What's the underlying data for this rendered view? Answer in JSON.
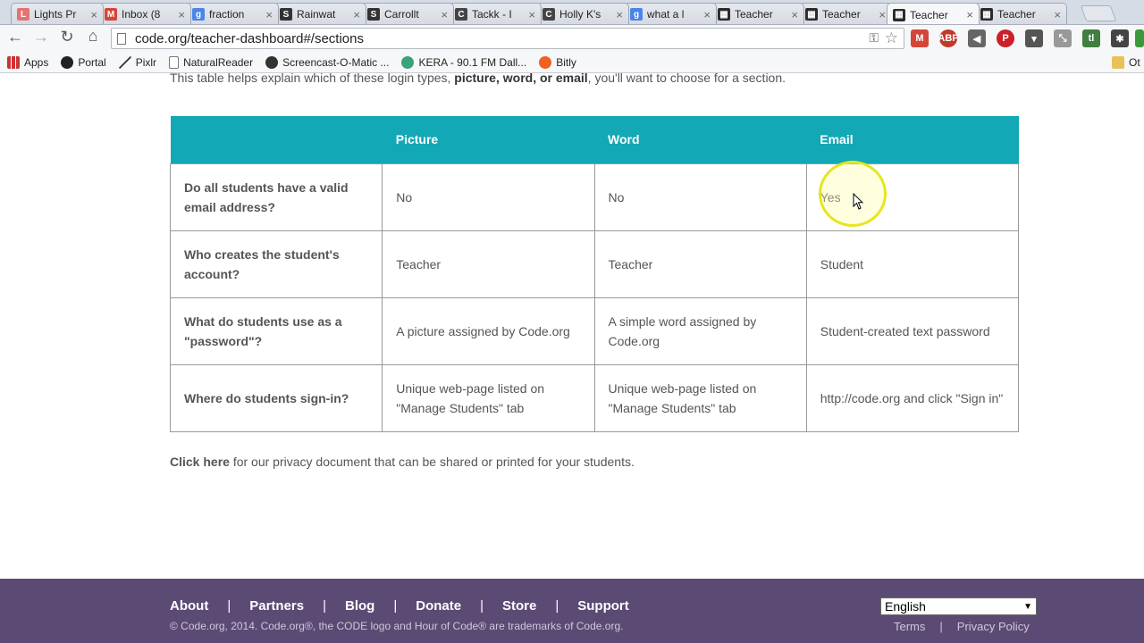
{
  "browser": {
    "tabs": [
      {
        "title": "Lights Pr",
        "icon_color": "#e57373",
        "icon_text": "L"
      },
      {
        "title": "Inbox (8",
        "icon_color": "#d44638",
        "icon_text": "M"
      },
      {
        "title": "fraction",
        "icon_color": "#4a86e8",
        "icon_text": "g"
      },
      {
        "title": "Rainwat",
        "icon_color": "#333333",
        "icon_text": "S"
      },
      {
        "title": "Carrollt",
        "icon_color": "#333333",
        "icon_text": "S"
      },
      {
        "title": "Tackk - I",
        "icon_color": "#444444",
        "icon_text": "C"
      },
      {
        "title": "Holly K's",
        "icon_color": "#444444",
        "icon_text": "C"
      },
      {
        "title": "what a l",
        "icon_color": "#4a86e8",
        "icon_text": "g"
      },
      {
        "title": "Teacher",
        "icon_color": "#2b2b2b",
        "icon_text": "▦"
      },
      {
        "title": "Teacher",
        "icon_color": "#2b2b2b",
        "icon_text": "▦"
      },
      {
        "title": "Teacher",
        "icon_color": "#2b2b2b",
        "icon_text": "▦"
      },
      {
        "title": "Teacher",
        "icon_color": "#2b2b2b",
        "icon_text": "▦"
      }
    ],
    "active_tab": 10,
    "url": "code.org/teacher-dashboard#/sections",
    "bookmarks": [
      {
        "label": "Apps"
      },
      {
        "label": "Portal"
      },
      {
        "label": "Pixlr"
      },
      {
        "label": "NaturalReader"
      },
      {
        "label": "Screencast-O-Matic ..."
      },
      {
        "label": "KERA - 90.1 FM Dall..."
      },
      {
        "label": "Bitly"
      },
      {
        "label": "Ot"
      }
    ]
  },
  "page": {
    "intro_prefix": "This table helps explain which of these login types, ",
    "intro_bold": "picture, word, or email",
    "intro_suffix": ", you'll want to choose for a section.",
    "table": {
      "headers": [
        "",
        "Picture",
        "Word",
        "Email"
      ],
      "rows": [
        {
          "question": "Do all students have a valid email address?",
          "picture": "No",
          "word": "No",
          "email": "Yes"
        },
        {
          "question": "Who creates the student's account?",
          "picture": "Teacher",
          "word": "Teacher",
          "email": "Student"
        },
        {
          "question": "What do students use as a \"password\"?",
          "picture": "A picture assigned by Code.org",
          "word": "A simple word assigned by Code.org",
          "email": "Student-created text password"
        },
        {
          "question": "Where do students sign-in?",
          "picture": "Unique web-page listed on \"Manage Students\" tab",
          "word": "Unique web-page listed on \"Manage Students\" tab",
          "email": "http://code.org and click \"Sign in\""
        }
      ]
    },
    "note_link": "Click here",
    "note_text": " for our privacy document that can be shared or printed for your students."
  },
  "footer": {
    "nav": [
      "About",
      "Partners",
      "Blog",
      "Donate",
      "Store",
      "Support"
    ],
    "separator": "|",
    "copyright": "© Code.org, 2014. Code.org®, the CODE logo and Hour of Code® are trademarks of Code.org.",
    "language": "English",
    "links": [
      "Terms",
      "Privacy Policy"
    ]
  },
  "colors": {
    "table_header": "#13a8b5",
    "footer_bg": "#5b4b74"
  }
}
